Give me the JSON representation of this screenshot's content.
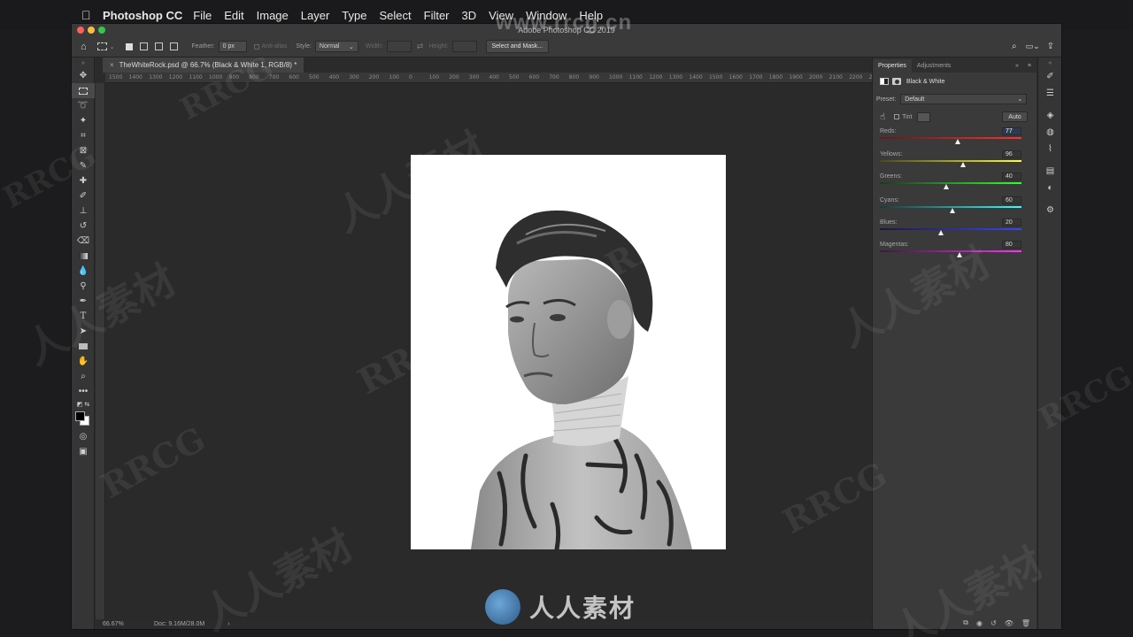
{
  "menubar": {
    "apple_icon": "apple-logo",
    "app_name": "Photoshop CC",
    "items": [
      "File",
      "Edit",
      "Image",
      "Layer",
      "Type",
      "Select",
      "Filter",
      "3D",
      "View",
      "Window",
      "Help"
    ]
  },
  "window": {
    "title": "Adobe Photoshop CC 2019"
  },
  "options_bar": {
    "feather_label": "Feather:",
    "feather_value": "0 px",
    "antialias_label": "Anti-alias",
    "style_label": "Style:",
    "style_value": "Normal",
    "width_label": "Width:",
    "height_label": "Height:",
    "select_mask_button": "Select and Mask..."
  },
  "document": {
    "tab_title": "TheWhiteRock.psd @ 66.7% (Black & White 1, RGB/8) *",
    "close_glyph": "×"
  },
  "ruler": {
    "ticks": [
      "1500",
      "1400",
      "1300",
      "1200",
      "1100",
      "1000",
      "900",
      "800",
      "700",
      "600",
      "500",
      "400",
      "300",
      "200",
      "100",
      "0",
      "100",
      "200",
      "300",
      "400",
      "500",
      "600",
      "700",
      "800",
      "900",
      "1000",
      "1100",
      "1200",
      "1300",
      "1400",
      "1500",
      "1600",
      "1700",
      "1800",
      "1900",
      "2000",
      "2100",
      "2200",
      "23"
    ]
  },
  "status": {
    "zoom": "66.67%",
    "doc_info": "Doc: 9.16M/28.0M",
    "arrow": "›"
  },
  "properties": {
    "tab_properties": "Properties",
    "tab_adjustments": "Adjustments",
    "adjustment_name": "Black & White",
    "preset_label": "Preset:",
    "preset_value": "Default",
    "tint_label": "Tint",
    "auto_button": "Auto",
    "sliders": [
      {
        "label": "Reds:",
        "value": "77",
        "position": 0.55,
        "gradient": [
          "#5a1c1c",
          "#ff3030"
        ]
      },
      {
        "label": "Yellows:",
        "value": "96",
        "position": 0.59,
        "gradient": [
          "#4a4a1a",
          "#ffff30"
        ]
      },
      {
        "label": "Greens:",
        "value": "40",
        "position": 0.47,
        "gradient": [
          "#1a3a1a",
          "#30ff30"
        ]
      },
      {
        "label": "Cyans:",
        "value": "60",
        "position": 0.51,
        "gradient": [
          "#1a3a3a",
          "#30ffff"
        ]
      },
      {
        "label": "Blues:",
        "value": "20",
        "position": 0.43,
        "gradient": [
          "#1a1a3a",
          "#4040ff"
        ]
      },
      {
        "label": "Magentas:",
        "value": "80",
        "position": 0.56,
        "gradient": [
          "#3a1a3a",
          "#ff30ff"
        ]
      }
    ]
  },
  "watermark": {
    "url": "www.rrcg.cn",
    "brand": "人人素材",
    "text": "RRCG"
  }
}
